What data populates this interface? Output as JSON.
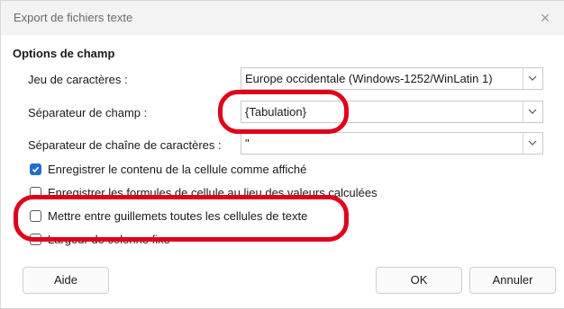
{
  "window": {
    "title": "Export de fichiers texte",
    "close_glyph": "×"
  },
  "section": {
    "title": "Options de champ"
  },
  "fields": [
    {
      "label": "Jeu de caractères :",
      "value": "Europe occidentale (Windows-1252/WinLatin 1)",
      "icon": "chevron-down-icon"
    },
    {
      "label": "Séparateur de champ :",
      "value": "{Tabulation}",
      "icon": "chevron-down-icon"
    },
    {
      "label": "Séparateur de chaîne de caractères :",
      "value": "\"",
      "icon": "chevron-down-icon"
    }
  ],
  "checkboxes": [
    {
      "label": "Enregistrer le contenu de la cellule comme affiché",
      "checked": true
    },
    {
      "label": "Enregistrer les formules de cellule au lieu des valeurs calculées",
      "checked": false
    },
    {
      "label": "Mettre entre guillemets toutes les cellules de texte",
      "checked": false
    },
    {
      "label": "Largeur de colonne fixe",
      "checked": false
    }
  ],
  "buttons": {
    "help": "Aide",
    "ok": "OK",
    "cancel": "Annuler"
  },
  "colors": {
    "highlight": "#e0001b",
    "checkbox_checked": "#1f6fd1",
    "titlebar": "#f3f3f3"
  }
}
